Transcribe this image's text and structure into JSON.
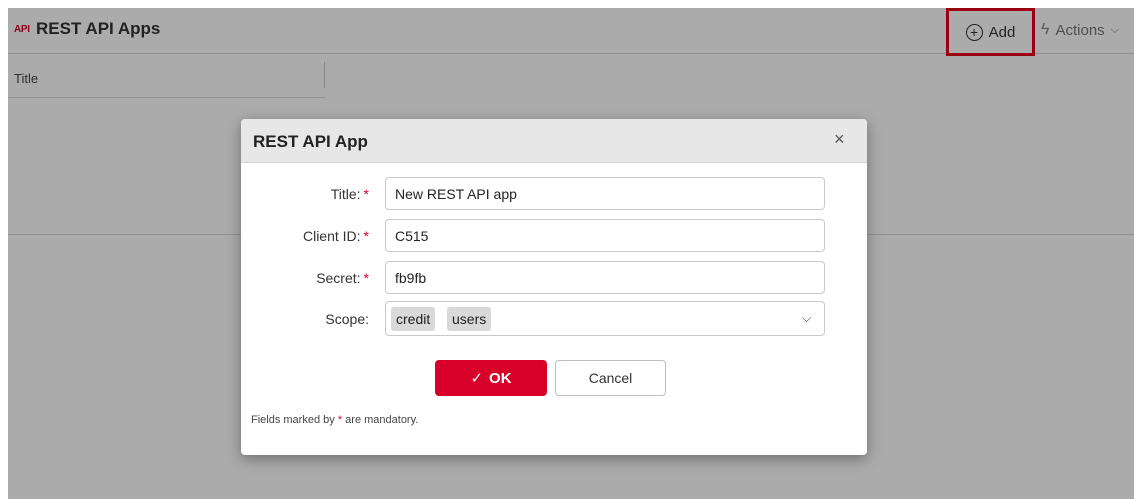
{
  "header": {
    "logo_text": "API",
    "title": "REST API Apps",
    "add_label": "Add",
    "actions_label": "Actions"
  },
  "grid": {
    "columns": [
      "Title"
    ]
  },
  "dialog": {
    "title": "REST API App",
    "close_glyph": "×",
    "fields": {
      "title": {
        "label": "Title:",
        "required_mark": "*",
        "value": "New REST API app"
      },
      "client_id": {
        "label": "Client ID:",
        "required_mark": "*",
        "value": "C515"
      },
      "secret": {
        "label": "Secret:",
        "required_mark": "*",
        "value": "fb9fb"
      },
      "scope": {
        "label": "Scope:",
        "tags": [
          "credit",
          "users"
        ]
      }
    },
    "ok_label": "OK",
    "cancel_label": "Cancel",
    "footnote": {
      "prefix": "Fields marked by",
      "mark": "*",
      "suffix": "are mandatory."
    }
  },
  "colors": {
    "accent": "#d8002a",
    "highlight_border": "#e8001c"
  },
  "icons": {
    "add": "plus-circle-icon",
    "actions": "lightning-icon",
    "close": "close-icon",
    "dropdown": "chevron-down-icon",
    "ok": "check-icon"
  }
}
